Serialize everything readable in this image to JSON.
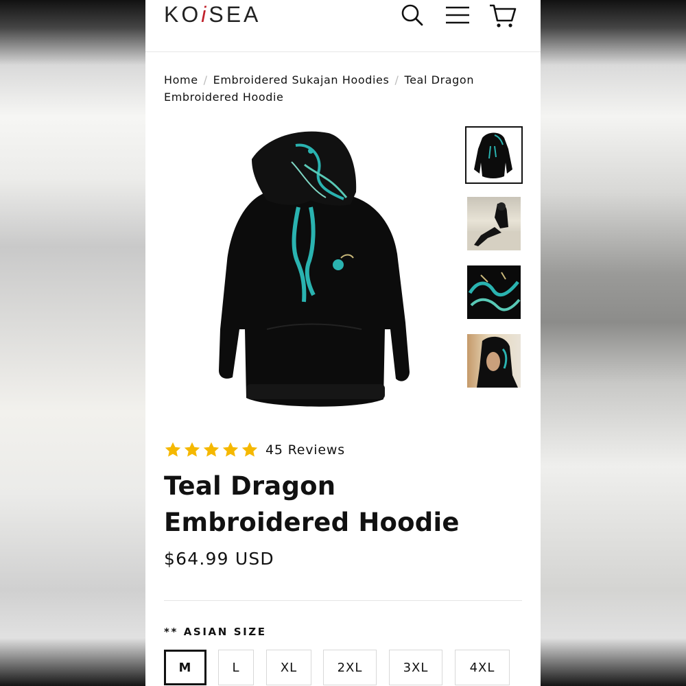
{
  "header": {
    "logo_left": "KO",
    "logo_mark": "i",
    "logo_right": "SEA",
    "icons": [
      "search-icon",
      "menu-icon",
      "cart-icon"
    ]
  },
  "breadcrumb": {
    "items": [
      "Home",
      "Embroidered Sukajan Hoodies",
      "Teal Dragon Embroidered Hoodie"
    ],
    "separator": "/"
  },
  "gallery": {
    "main_image": "black hoodie with teal dragon embroidery",
    "thumbnails": [
      "hoodie front",
      "model seated on steps",
      "dragon embroidery detail",
      "model wearing hood"
    ],
    "active_thumbnail": 0
  },
  "product": {
    "rating": 5,
    "reviews_label": "45 Reviews",
    "title": "Teal Dragon Embroidered Hoodie",
    "price": "$64.99 USD"
  },
  "sizes": {
    "label": "** ASIAN SIZE",
    "options": [
      "M",
      "L",
      "XL",
      "2XL",
      "3XL",
      "4XL"
    ],
    "selected": "M"
  },
  "colors": {
    "accent_teal": "#2ab3b0",
    "star": "#f5b800",
    "logo_mark": "#c0212b",
    "text": "#111111"
  }
}
